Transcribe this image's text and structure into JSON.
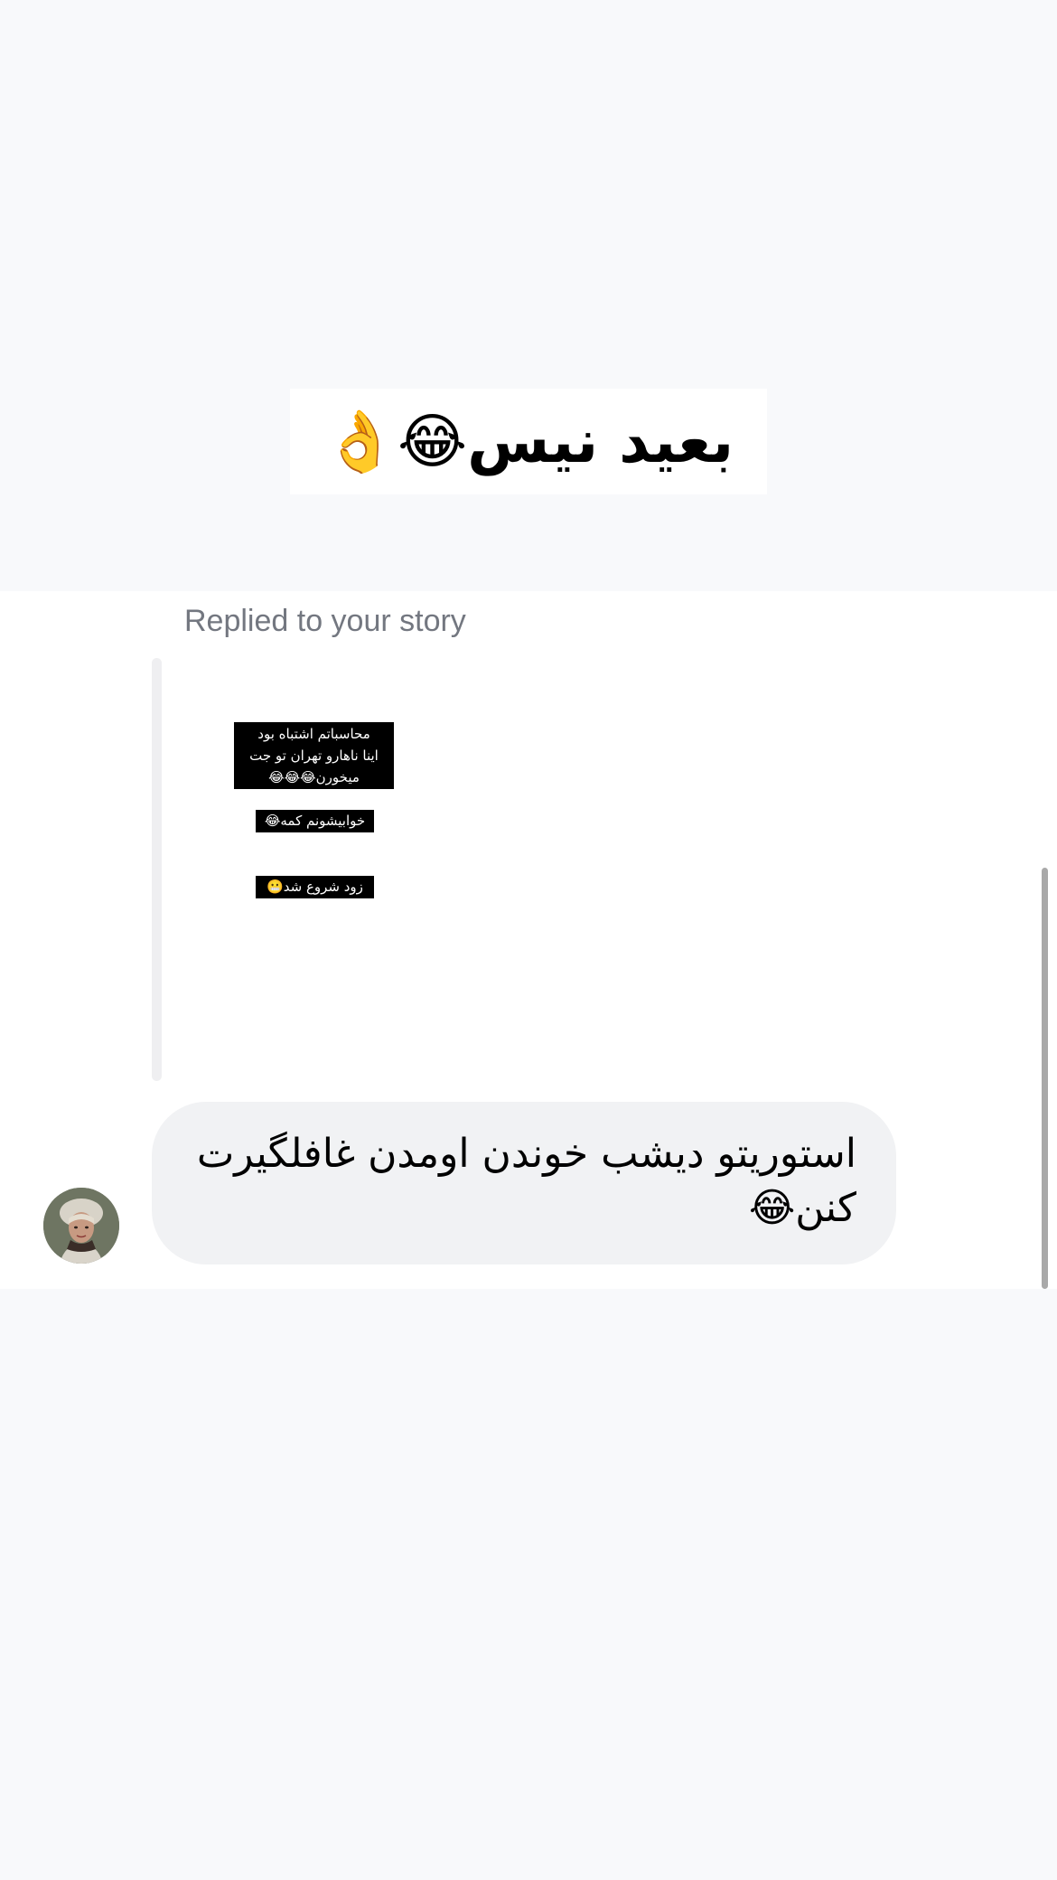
{
  "sticker": {
    "caption": "بعید نیس😂👌"
  },
  "reply": {
    "label": "Replied to your story",
    "story_texts": [
      "محاسباتم اشتباه بود\nاینا ناهارو تهران تو جت\nمیخورن😂😂😂",
      "خوابیشونم کمه😂",
      "زود شروع شد😬"
    ]
  },
  "message": {
    "text": "استوریتو دیشب خوندن اومدن غافلگیرت کنن😂"
  },
  "colors": {
    "page_bg": "#f8f9fb",
    "panel_bg": "#ffffff",
    "bubble_bg": "#f1f2f4",
    "muted_text": "#737780",
    "quote_bar": "#efeff1",
    "scrollbar": "#a9a9a9"
  },
  "icons": {
    "avatar": "user-avatar-photo"
  }
}
